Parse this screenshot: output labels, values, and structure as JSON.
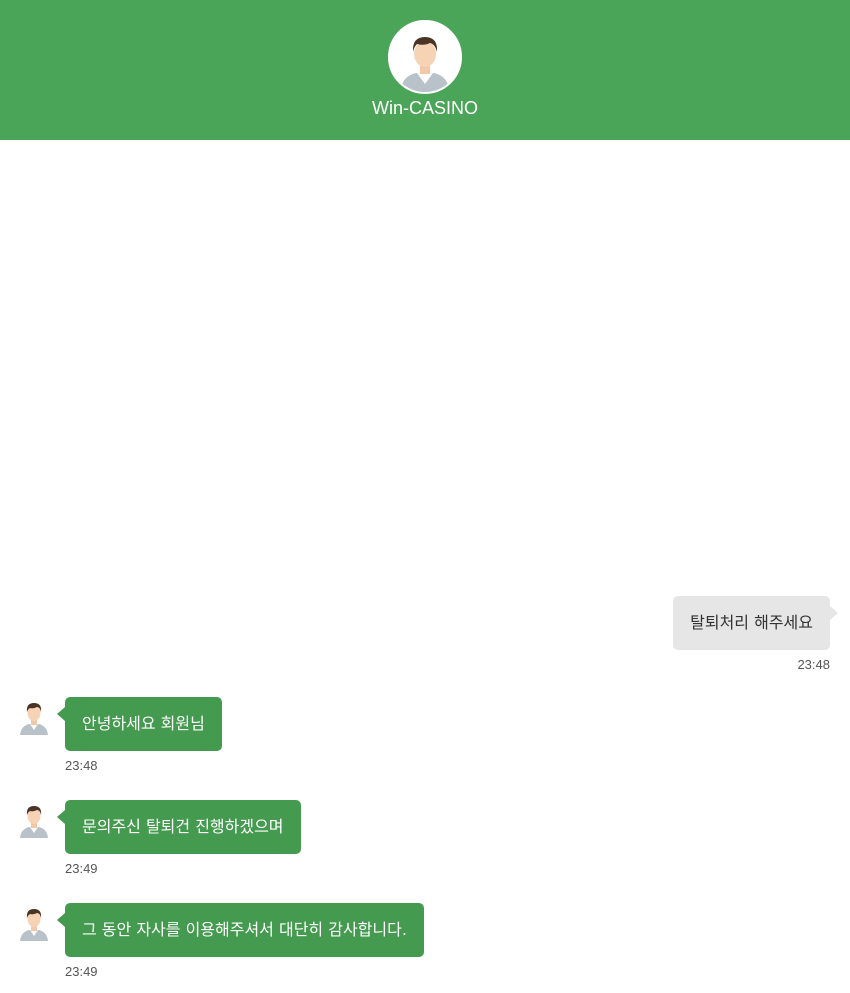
{
  "header": {
    "title": "Win-CASINO",
    "avatar_icon": "user-avatar-icon",
    "background_color": "#4aa558"
  },
  "messages": [
    {
      "sender": "user",
      "text": "탈퇴처리 해주세요",
      "time": "23:48"
    },
    {
      "sender": "agent",
      "text": "안녕하세요 회원님",
      "time": "23:48"
    },
    {
      "sender": "agent",
      "text": "문의주신 탈퇴건 진행하겠으며",
      "time": "23:49"
    },
    {
      "sender": "agent",
      "text": "그 동안 자사를 이용해주셔서 대단히 감사합니다.",
      "time": "23:49"
    }
  ],
  "colors": {
    "agent_bubble": "#449a4f",
    "user_bubble": "#e6e6e6",
    "agent_text": "#ffffff",
    "user_text": "#333333"
  }
}
